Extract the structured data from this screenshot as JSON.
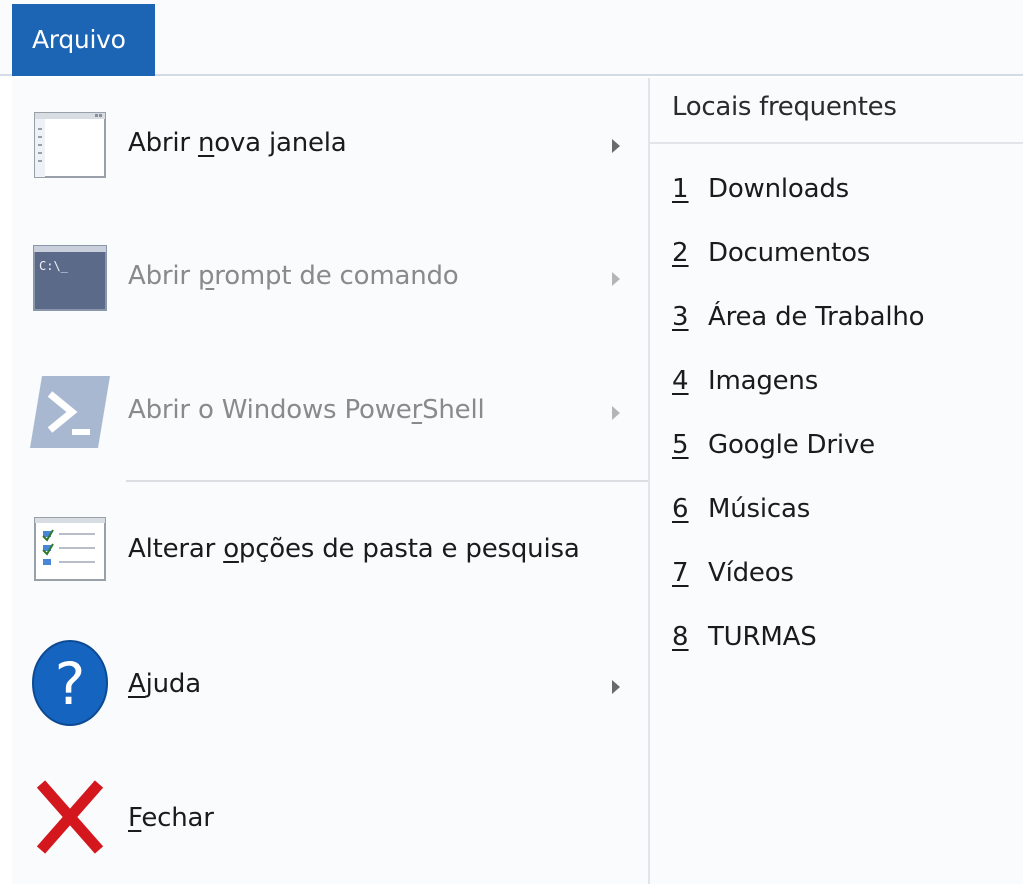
{
  "file_tab": {
    "label": "Arquivo"
  },
  "menu": {
    "items": [
      {
        "icon": "new-window-icon",
        "pre": "Abrir ",
        "mnemonic": "n",
        "post": "ova janela",
        "disabled": false,
        "has_submenu": true
      },
      {
        "icon": "command-prompt-icon",
        "icon_text": "C:\\_",
        "pre": "Abrir ",
        "mnemonic": "p",
        "post": "rompt de comando",
        "disabled": true,
        "has_submenu": true
      },
      {
        "icon": "powershell-icon",
        "pre": "Abrir o Windows Powe",
        "mnemonic": "r",
        "post": "Shell",
        "disabled": true,
        "has_submenu": true
      },
      {
        "icon": "folder-options-icon",
        "pre": "Alterar ",
        "mnemonic": "o",
        "post": "pções de pasta e pesquisa",
        "disabled": false,
        "has_submenu": false
      },
      {
        "icon": "help-icon",
        "icon_text": "?",
        "pre": "",
        "mnemonic": "A",
        "post": "juda",
        "disabled": false,
        "has_submenu": true
      },
      {
        "icon": "close-x-icon",
        "pre": "",
        "mnemonic": "F",
        "post": "echar",
        "disabled": false,
        "has_submenu": false
      }
    ]
  },
  "recent": {
    "header": "Locais frequentes",
    "items": [
      {
        "num": "1",
        "name": "Downloads"
      },
      {
        "num": "2",
        "name": "Documentos"
      },
      {
        "num": "3",
        "name": "Área de Trabalho"
      },
      {
        "num": "4",
        "name": "Imagens"
      },
      {
        "num": "5",
        "name": "Google Drive"
      },
      {
        "num": "6",
        "name": "Músicas"
      },
      {
        "num": "7",
        "name": "Vídeos"
      },
      {
        "num": "8",
        "name": "TURMAS"
      }
    ]
  },
  "colors": {
    "accent": "#1c64b4",
    "help_blue": "#1565c0",
    "close_red": "#d4161d",
    "disabled_text": "#8a8a8a"
  }
}
